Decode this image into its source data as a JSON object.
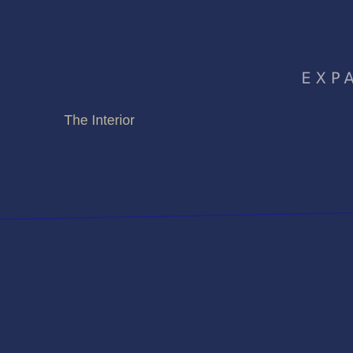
{
  "heading": "EXPA",
  "label": "The Interior",
  "colors": {
    "background": "#232e57",
    "heading_text": "#a9a9b6",
    "label_text": "#b9b39a",
    "divider": "#1a237a"
  }
}
